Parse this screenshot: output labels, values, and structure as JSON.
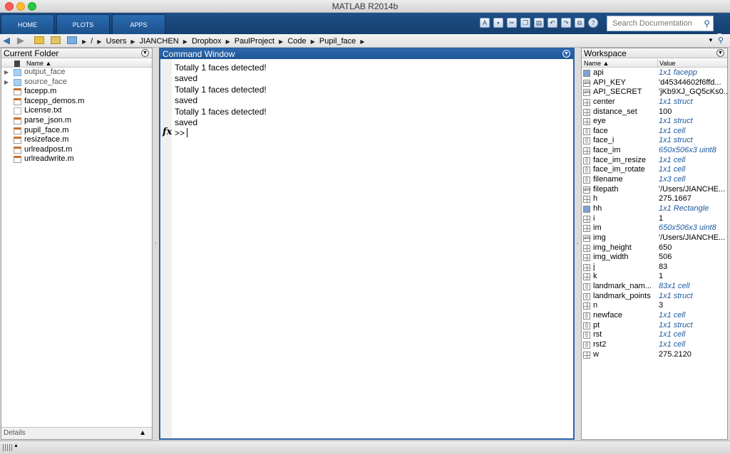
{
  "window": {
    "title": "MATLAB R2014b"
  },
  "toolstrip": {
    "tabs": [
      "HOME",
      "PLOTS",
      "APPS"
    ],
    "search_placeholder": "Search Documentation"
  },
  "address": {
    "path": [
      "/",
      "Users",
      "JIANCHEN",
      "Dropbox",
      "PaulProject",
      "Code",
      "Pupil_face"
    ]
  },
  "current_folder": {
    "title": "Current Folder",
    "column": "Name ▲",
    "items": [
      {
        "name": "output_face",
        "type": "folder"
      },
      {
        "name": "source_face",
        "type": "folder"
      },
      {
        "name": "facepp.m",
        "type": "mfile"
      },
      {
        "name": "facepp_demos.m",
        "type": "mfile"
      },
      {
        "name": "License.txt",
        "type": "txt"
      },
      {
        "name": "parse_json.m",
        "type": "mfile"
      },
      {
        "name": "pupil_face.m",
        "type": "mfile"
      },
      {
        "name": "resizeface.m",
        "type": "mfile"
      },
      {
        "name": "urlreadpost.m",
        "type": "mfile"
      },
      {
        "name": "urlreadwrite.m",
        "type": "mfile"
      }
    ],
    "details_label": "Details"
  },
  "command_window": {
    "title": "Command Window",
    "lines": [
      "Totally 1 faces detected!",
      "saved",
      "Totally 1 faces detected!",
      "saved",
      "Totally 1 faces detected!",
      "saved"
    ],
    "prompt": ">>",
    "fx": "fx"
  },
  "workspace": {
    "title": "Workspace",
    "col_name": "Name ▲",
    "col_value": "Value",
    "vars": [
      {
        "name": "api",
        "value": "1x1 facepp",
        "icon": "obj",
        "italic": true
      },
      {
        "name": "API_KEY",
        "value": "'d45344602f6ffd...",
        "icon": "abc",
        "italic": false
      },
      {
        "name": "API_SECRET",
        "value": "'jKb9XJ_GQ5cKs0...",
        "icon": "abc",
        "italic": false
      },
      {
        "name": "center",
        "value": "1x1 struct",
        "icon": "grid",
        "italic": true
      },
      {
        "name": "distance_set",
        "value": "100",
        "icon": "grid",
        "italic": false
      },
      {
        "name": "eye",
        "value": "1x1 struct",
        "icon": "grid",
        "italic": true
      },
      {
        "name": "face",
        "value": "1x1 cell",
        "icon": "cell",
        "italic": true
      },
      {
        "name": "face_i",
        "value": "1x1 struct",
        "icon": "cell",
        "italic": true
      },
      {
        "name": "face_im",
        "value": "650x506x3 uint8",
        "icon": "grid",
        "italic": true
      },
      {
        "name": "face_im_resize",
        "value": "1x1 cell",
        "icon": "cell",
        "italic": true
      },
      {
        "name": "face_im_rotate",
        "value": "1x1 cell",
        "icon": "cell",
        "italic": true
      },
      {
        "name": "filename",
        "value": "1x3 cell",
        "icon": "cell",
        "italic": true
      },
      {
        "name": "filepath",
        "value": "'/Users/JIANCHE...",
        "icon": "abc",
        "italic": false
      },
      {
        "name": "h",
        "value": "275.1667",
        "icon": "grid",
        "italic": false
      },
      {
        "name": "hh",
        "value": "1x1 Rectangle",
        "icon": "obj",
        "italic": true
      },
      {
        "name": "i",
        "value": "1",
        "icon": "grid",
        "italic": false
      },
      {
        "name": "im",
        "value": "650x506x3 uint8",
        "icon": "grid",
        "italic": true
      },
      {
        "name": "img",
        "value": "'/Users/JIANCHE...",
        "icon": "abc",
        "italic": false
      },
      {
        "name": "img_height",
        "value": "650",
        "icon": "grid",
        "italic": false
      },
      {
        "name": "img_width",
        "value": "506",
        "icon": "grid",
        "italic": false
      },
      {
        "name": "j",
        "value": "83",
        "icon": "grid",
        "italic": false
      },
      {
        "name": "k",
        "value": "1",
        "icon": "grid",
        "italic": false
      },
      {
        "name": "landmark_nam...",
        "value": "83x1 cell",
        "icon": "cell",
        "italic": true
      },
      {
        "name": "landmark_points",
        "value": "1x1 struct",
        "icon": "cell",
        "italic": true
      },
      {
        "name": "n",
        "value": "3",
        "icon": "grid",
        "italic": false
      },
      {
        "name": "newface",
        "value": "1x1 cell",
        "icon": "cell",
        "italic": true
      },
      {
        "name": "pt",
        "value": "1x1 struct",
        "icon": "cell",
        "italic": true
      },
      {
        "name": "rst",
        "value": "1x1 cell",
        "icon": "cell",
        "italic": true
      },
      {
        "name": "rst2",
        "value": "1x1 cell",
        "icon": "cell",
        "italic": true
      },
      {
        "name": "w",
        "value": "275.2120",
        "icon": "grid",
        "italic": false
      }
    ]
  }
}
